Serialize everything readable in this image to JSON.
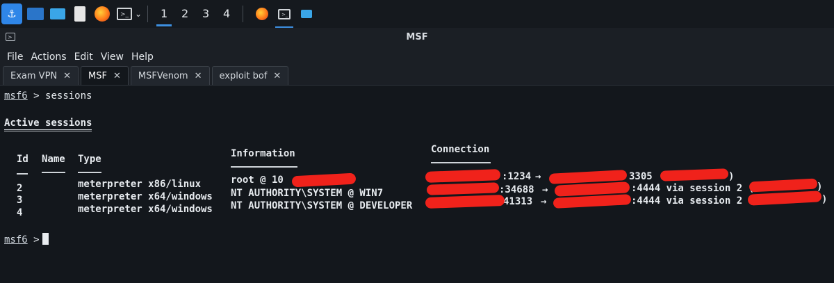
{
  "taskbar": {
    "workspaces": [
      "1",
      "2",
      "3",
      "4"
    ],
    "active_workspace": "1"
  },
  "window": {
    "title": "MSF",
    "menu": [
      "File",
      "Actions",
      "Edit",
      "View",
      "Help"
    ],
    "tabs": [
      {
        "label": "Exam VPN"
      },
      {
        "label": "MSF"
      },
      {
        "label": "MSFVenom"
      },
      {
        "label": "exploit bof"
      }
    ],
    "active_tab": "MSF"
  },
  "terminal": {
    "prompt": "msf6",
    "prompt_symbol": ">",
    "command": "sessions",
    "heading": "Active sessions",
    "columns": {
      "id": "Id",
      "name": "Name",
      "type": "Type",
      "information": "Information",
      "connection": "Connection"
    },
    "sessions": [
      {
        "id": "2",
        "type": "meterpreter x86/linux",
        "info": "root @ 10",
        "conn_a": ":1234",
        "arrow": "→",
        "conn_b": "3305",
        "conn_c": ")"
      },
      {
        "id": "3",
        "type": "meterpreter x64/windows",
        "info": "NT AUTHORITY\\SYSTEM @ WIN7",
        "conn_a": ":34688",
        "arrow": "→",
        "conn_b": ":4444 via session 2 (",
        "conn_c": ")"
      },
      {
        "id": "4",
        "type": "meterpreter x64/windows",
        "info": "NT AUTHORITY\\SYSTEM @ DEVELOPER",
        "conn_a": "41313",
        "arrow": "→",
        "conn_b": ":4444 via session 2 (",
        "conn_c": ")"
      }
    ]
  }
}
